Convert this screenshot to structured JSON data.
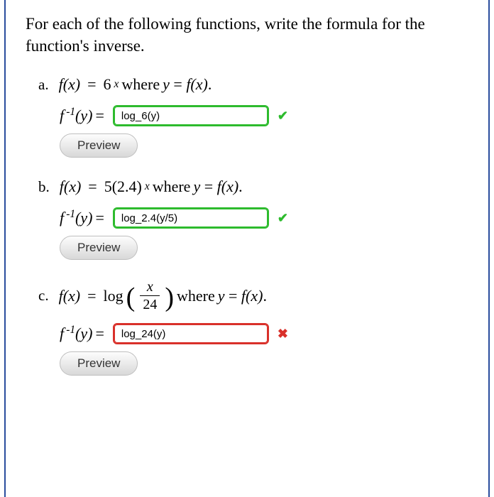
{
  "intro": "For each of the following functions, write the formula for the function's inverse.",
  "parts": {
    "a": {
      "marker": "a.",
      "func_lhs": "f(x)",
      "eq": "=",
      "base": "6",
      "exp": "x",
      "where": " where ",
      "y_eq": "y = f(x).",
      "finv": "f ⁻¹(y)",
      "answer": "log_6(y)",
      "status": "correct",
      "preview": "Preview"
    },
    "b": {
      "marker": "b.",
      "func_lhs": "f(x)",
      "eq": "=",
      "coef": "5(2.4)",
      "exp": "x",
      "where": " where ",
      "y_eq": "y = f(x).",
      "finv": "f ⁻¹(y)",
      "answer": "log_2.4(y/5)",
      "status": "correct",
      "preview": "Preview"
    },
    "c": {
      "marker": "c.",
      "func_lhs": "f(x)",
      "eq": "=",
      "log": "log",
      "frac_num": "x",
      "frac_den": "24",
      "where": " where ",
      "y_eq": "y = f(x).",
      "finv": "f ⁻¹(y)",
      "answer": "log_24(y)",
      "status": "incorrect",
      "preview": "Preview"
    }
  },
  "icons": {
    "correct": "✔",
    "incorrect": "✖"
  }
}
